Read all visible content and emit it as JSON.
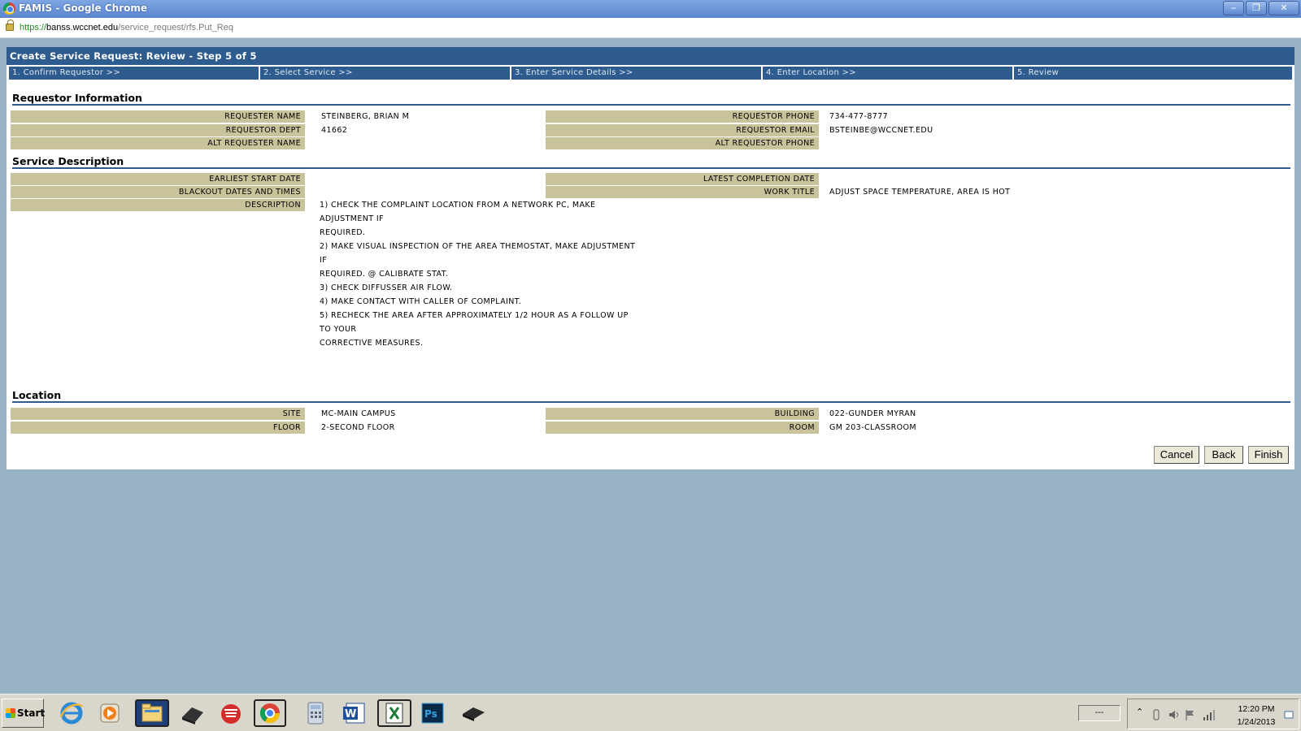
{
  "window": {
    "title": "FAMIS - Google Chrome",
    "url_scheme": "https://",
    "url_host": "banss.wccnet.edu",
    "url_path": "/service_request/rfs.Put_Req",
    "minimize": "‒",
    "restore": "❐",
    "close": "✕"
  },
  "header": {
    "title": "Create Service Request: Review - Step 5 of 5",
    "steps": [
      {
        "label": "1. Confirm Requestor >>"
      },
      {
        "label": "2. Select Service >>"
      },
      {
        "label": "3. Enter Service Details >>"
      },
      {
        "label": "4. Enter Location >>"
      },
      {
        "label": "5. Review"
      }
    ]
  },
  "requestor": {
    "section_title": "Requestor Information",
    "requester_name_label": "REQUESTER NAME",
    "requester_name": "STEINBERG, BRIAN M",
    "requestor_dept_label": "REQUESTOR DEPT",
    "requestor_dept": "41662",
    "alt_requester_name_label": "ALT REQUESTER NAME",
    "alt_requester_name": "",
    "requestor_phone_label": "REQUESTOR PHONE",
    "requestor_phone": "734-477-8777",
    "requestor_email_label": "REQUESTOR EMAIL",
    "requestor_email": "BSTEINBE@WCCNET.EDU",
    "alt_requestor_phone_label": "ALT REQUESTOR PHONE",
    "alt_requestor_phone": ""
  },
  "service": {
    "section_title": "Service Description",
    "earliest_start_label": "EARLIEST START DATE",
    "earliest_start": "",
    "blackout_label": "BLACKOUT DATES AND TIMES",
    "blackout": "",
    "description_label": "DESCRIPTION",
    "latest_completion_label": "LATEST COMPLETION DATE",
    "latest_completion": "",
    "work_title_label": "WORK TITLE",
    "work_title": "ADJUST SPACE TEMPERATURE, AREA IS HOT",
    "description_lines": [
      "1) CHECK THE COMPLAINT LOCATION FROM A NETWORK PC, MAKE",
      "ADJUSTMENT IF",
      "REQUIRED.",
      "2) MAKE VISUAL INSPECTION OF THE AREA THEMOSTAT, MAKE ADJUSTMENT",
      "IF",
      "REQUIRED. @ CALIBRATE STAT.",
      "3) CHECK DIFFUSSER AIR FLOW.",
      "4) MAKE CONTACT WITH CALLER OF COMPLAINT.",
      "5) RECHECK THE AREA AFTER APPROXIMATELY 1/2 HOUR AS A FOLLOW UP",
      "TO YOUR",
      "CORRECTIVE MEASURES."
    ]
  },
  "location": {
    "section_title": "Location",
    "site_label": "SITE",
    "site": "MC-MAIN CAMPUS",
    "floor_label": "FLOOR",
    "floor": "2-SECOND FLOOR",
    "building_label": "BUILDING",
    "building": "022-GUNDER MYRAN",
    "room_label": "ROOM",
    "room": "GM 203-CLASSROOM"
  },
  "buttons": {
    "cancel": "Cancel",
    "back": "Back",
    "finish": "Finish"
  },
  "taskbar": {
    "start": "Start",
    "lang": "---",
    "time": "12:20 PM",
    "date": "1/24/2013"
  }
}
